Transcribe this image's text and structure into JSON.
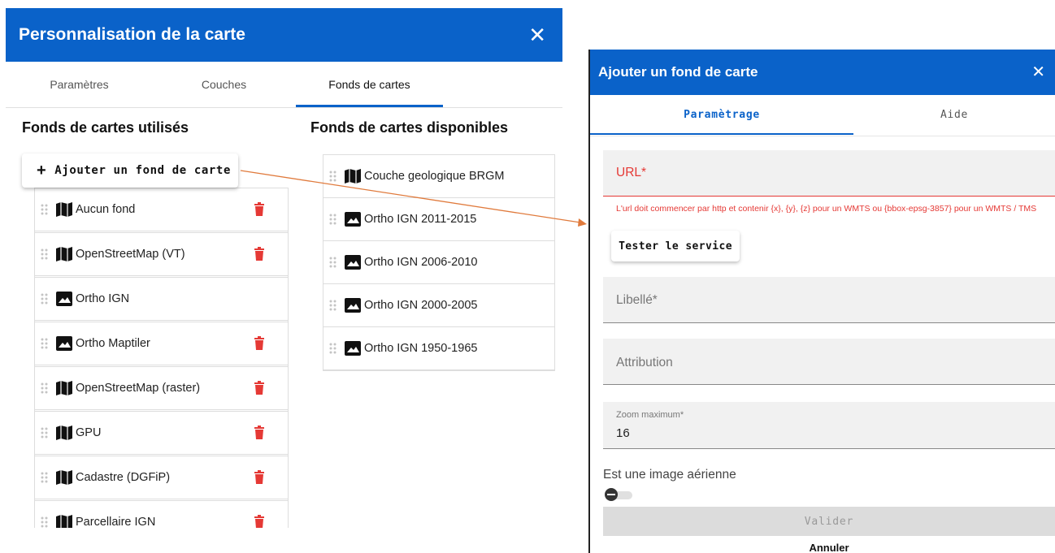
{
  "left_panel": {
    "title": "Personnalisation de la carte",
    "tabs": [
      "Paramètres",
      "Couches",
      "Fonds de cartes"
    ],
    "active_tab": "Fonds de cartes",
    "used_title": "Fonds de cartes utilisés",
    "available_title": "Fonds de cartes disponibles",
    "add_button": "Ajouter un fond de carte",
    "used_items": [
      {
        "label": "Aucun fond",
        "icon": "map-icon"
      },
      {
        "label": "OpenStreetMap (VT)",
        "icon": "map-icon"
      },
      {
        "label": "Ortho IGN",
        "icon": "image-icon"
      },
      {
        "label": "Ortho Maptiler",
        "icon": "image-icon"
      },
      {
        "label": "OpenStreetMap (raster)",
        "icon": "map-icon"
      },
      {
        "label": "GPU",
        "icon": "map-icon"
      },
      {
        "label": "Cadastre (DGFiP)",
        "icon": "map-icon"
      },
      {
        "label": "Parcellaire IGN",
        "icon": "map-icon"
      }
    ],
    "available_items": [
      {
        "label": "Couche geologique BRGM",
        "icon": "map-icon"
      },
      {
        "label": "Ortho IGN 2011-2015",
        "icon": "image-icon"
      },
      {
        "label": "Ortho IGN 2006-2010",
        "icon": "image-icon"
      },
      {
        "label": "Ortho IGN 2000-2005",
        "icon": "image-icon"
      },
      {
        "label": "Ortho IGN 1950-1965",
        "icon": "image-icon"
      }
    ]
  },
  "dialog": {
    "title": "Ajouter un fond de carte",
    "tabs": [
      "Paramètrage",
      "Aide"
    ],
    "active_tab": "Paramètrage",
    "url_label": "URL*",
    "url_hint": "L'url doit commencer par http et contenir {x}, {y}, {z} pour un WMTS ou {bbox-epsg-3857} pour un WMTS / TMS",
    "test_button": "Tester le service",
    "label_field": "Libellé*",
    "attribution_field": "Attribution",
    "zoom_label": "Zoom maximum*",
    "zoom_value": "16",
    "aerial_label": "Est une image aérienne",
    "aerial_checked": false,
    "validate_button": "Valider",
    "cancel_button": "Annuler"
  },
  "colors": {
    "primary": "#0a62c9",
    "error": "#e53935",
    "delete": "#e53935",
    "arrow": "#e07a3c"
  }
}
